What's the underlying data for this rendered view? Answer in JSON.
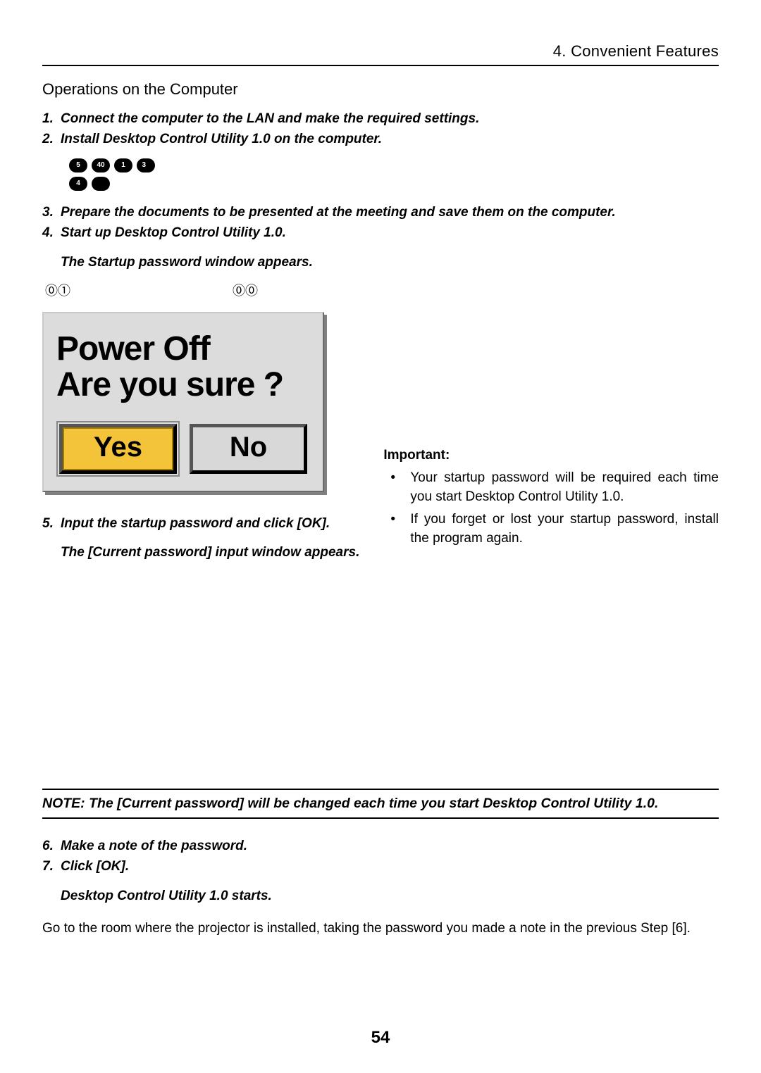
{
  "header": {
    "chapter": "4. Convenient Features"
  },
  "section": {
    "title": "Operations on the Computer"
  },
  "steps_block1": {
    "s1_num": "1.",
    "s1": "Connect the computer to the LAN and make the required settings.",
    "s2_num": "2.",
    "s2": "Install Desktop Control Utility 1.0 on the computer.",
    "s3_num": "3.",
    "s3": "Prepare the documents to be presented at the meeting and save them on the computer.",
    "s4_num": "4.",
    "s4": "Start up Desktop Control Utility 1.0.",
    "s4_sub": "The Startup password window appears."
  },
  "dialog": {
    "title": "Power Off\nAre you sure ?",
    "yes": "Yes",
    "no": "No"
  },
  "important": {
    "head": "Important:",
    "b1": "Your startup password will be required each time you start Desktop Control Utility 1.0.",
    "b2": "If you forget or lost your startup password, install the program again."
  },
  "steps_block2": {
    "s5_num": "5.",
    "s5": "Input the startup password and click [OK].",
    "s5_sub": "The [Current password] input window appears."
  },
  "note": "NOTE: The [Current password] will be changed each time you start Desktop Control Utility 1.0.",
  "steps_block3": {
    "s6_num": "6.",
    "s6": "Make a note of the password.",
    "s7_num": "7.",
    "s7": "Click [OK].",
    "s7_sub": "Desktop Control Utility 1.0 starts."
  },
  "closing": "Go to the room where the projector is installed, taking the password you made a note in the previous Step [6].",
  "footer": {
    "page": "54"
  }
}
